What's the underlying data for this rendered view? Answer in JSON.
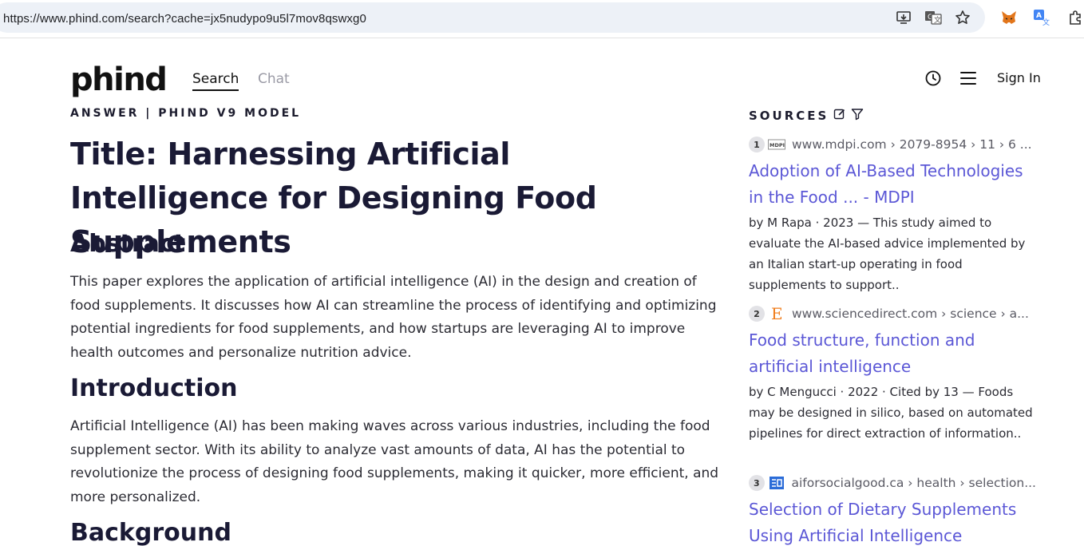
{
  "browser": {
    "url": "https://www.phind.com/search?cache=jx5nudypo9u5l7mov8qswxg0",
    "icons": [
      "install-app-icon",
      "translate-icon",
      "bookmark-star-icon",
      "metamask-icon",
      "google-translate-extension-icon",
      "extensions-puzzle-icon"
    ]
  },
  "header": {
    "logo": "phind",
    "nav": {
      "search": "Search",
      "chat": "Chat"
    },
    "signin": "Sign In"
  },
  "answer": {
    "label": "ANSWER | PHIND V9 MODEL",
    "title": "Title: Harnessing Artificial Intelligence for Designing Food Supplements",
    "sections": [
      {
        "heading": "Abstract",
        "text": "This paper explores the application of artificial intelligence (AI) in the design and creation of food supplements. It discusses how AI can streamline the process of identifying and optimizing potential ingredients for food supplements, and how startups are leveraging AI to improve health outcomes and personalize nutrition advice."
      },
      {
        "heading": "Introduction",
        "text": "Artificial Intelligence (AI) has been making waves across various industries, including the food supplement sector. With its ability to analyze vast amounts of data, AI has the potential to revolutionize the process of designing food supplements, making it quicker, more efficient, and more personalized."
      },
      {
        "heading": "Background",
        "text": ""
      }
    ]
  },
  "sources": {
    "label": "SOURCES",
    "items": [
      {
        "num": "1",
        "favicon": "mdpi-favicon",
        "url": "www.mdpi.com › 2079-8954 › 11 › 6 ...",
        "title": "Adoption of AI-Based Technologies in the Food ... - MDPI",
        "desc": "by M Rapa · 2023 — This study aimed to evaluate the AI-based advice implemented by an Italian start-up operating in food supplements to support.."
      },
      {
        "num": "2",
        "favicon": "elsevier-favicon",
        "url": "www.sciencedirect.com › science › a...",
        "title": "Food structure, function and artificial intelligence",
        "desc": "by C Mengucci · 2022 · Cited by 13 — Foods may be designed in silico, based on automated pipelines for direct extraction of information.."
      },
      {
        "num": "3",
        "favicon": "aiforsocialgood-favicon",
        "url": "aiforsocialgood.ca › health › selection...",
        "title": "Selection of Dietary Supplements Using Artificial Intelligence",
        "desc": ""
      }
    ]
  },
  "colors": {
    "link": "#5b57d6",
    "heading": "#1a1a35",
    "urlbar_bg": "#edf1f7"
  }
}
